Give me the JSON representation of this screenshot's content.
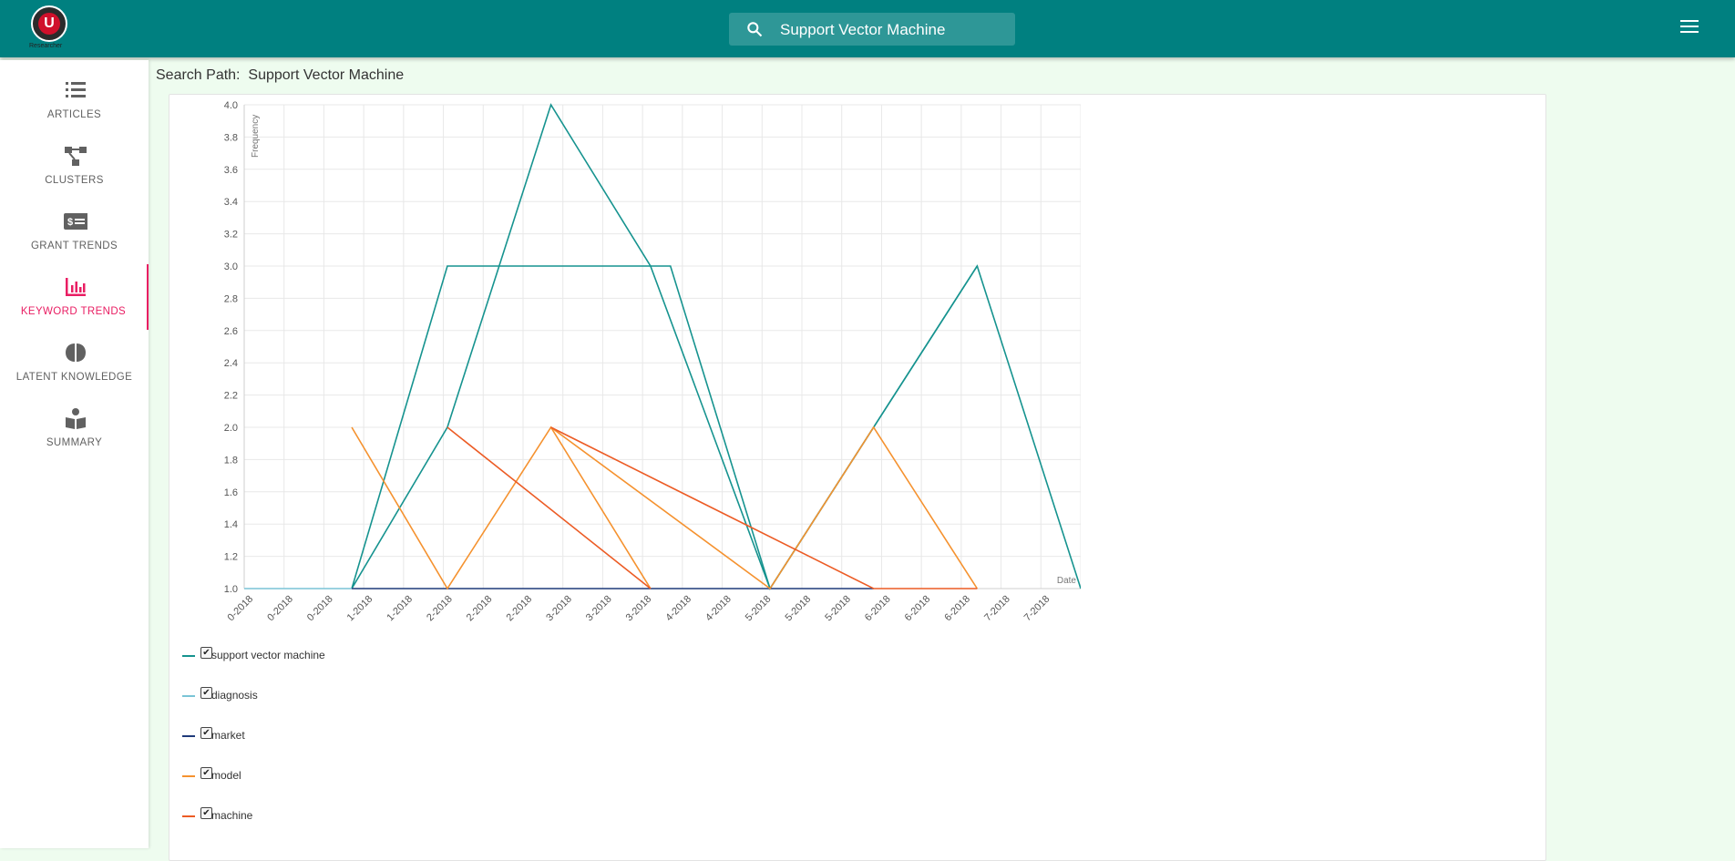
{
  "app": {
    "logo_text": "Researcher",
    "logo_letter": "U"
  },
  "search": {
    "value": "Support Vector Machine"
  },
  "sidebar": {
    "items": [
      {
        "label": "ARTICLES",
        "icon": "list-icon",
        "active": false
      },
      {
        "label": "CLUSTERS",
        "icon": "cluster-icon",
        "active": false
      },
      {
        "label": "GRANT TRENDS",
        "icon": "money-card-icon",
        "active": false
      },
      {
        "label": "KEYWORD TRENDS",
        "icon": "bar-chart-icon",
        "active": true
      },
      {
        "label": "LATENT KNOWLEDGE",
        "icon": "brain-icon",
        "active": false
      },
      {
        "label": "SUMMARY",
        "icon": "reader-icon",
        "active": false
      }
    ]
  },
  "main": {
    "search_path_label": "Search Path:",
    "search_path_value": "Support Vector Machine"
  },
  "chart_data": {
    "type": "line",
    "ylabel": "Frequency",
    "xlabel": "Date",
    "ylim": [
      1.0,
      4.0
    ],
    "yticks": [
      "1.0",
      "1.2",
      "1.4",
      "1.6",
      "1.8",
      "2.0",
      "2.2",
      "2.4",
      "2.6",
      "2.8",
      "3.0",
      "3.2",
      "3.4",
      "3.6",
      "3.8",
      "4.0"
    ],
    "categories": [
      "0-2018",
      "0-2018",
      "0-2018",
      "1-2018",
      "1-2018",
      "2-2018",
      "2-2018",
      "2-2018",
      "3-2018",
      "3-2018",
      "3-2018",
      "4-2018",
      "4-2018",
      "5-2018",
      "5-2018",
      "5-2018",
      "6-2018",
      "6-2018",
      "6-2018",
      "7-2018",
      "7-2018"
    ],
    "series": [
      {
        "name": "support vector machine",
        "color": "#16938f",
        "points": [
          [
            2.7,
            1.0
          ],
          [
            5.1,
            3.0
          ],
          [
            10.7,
            3.0
          ],
          [
            13.2,
            1.0
          ],
          [
            15.8,
            2.0
          ],
          [
            18.4,
            3.0
          ],
          [
            21.0,
            1.0
          ]
        ]
      },
      {
        "name": "support vector machine",
        "color": "#16938f",
        "points": [
          [
            2.7,
            1.0
          ],
          [
            5.1,
            2.0
          ],
          [
            7.7,
            4.0
          ],
          [
            10.2,
            3.0
          ],
          [
            13.2,
            1.0
          ],
          [
            18.4,
            3.0
          ]
        ]
      },
      {
        "name": "diagnosis",
        "color": "#7ac4d6",
        "points": [
          [
            0.0,
            1.0
          ],
          [
            2.7,
            1.0
          ]
        ]
      },
      {
        "name": "market",
        "color": "#1f3a7a",
        "points": [
          [
            2.7,
            1.0
          ],
          [
            15.8,
            1.0
          ]
        ]
      },
      {
        "name": "model",
        "color": "#f5922f",
        "points": [
          [
            2.7,
            2.0
          ],
          [
            5.1,
            1.0
          ],
          [
            7.7,
            2.0
          ],
          [
            10.2,
            1.0
          ]
        ]
      },
      {
        "name": "model",
        "color": "#f5922f",
        "points": [
          [
            7.7,
            2.0
          ],
          [
            13.2,
            1.0
          ],
          [
            15.8,
            2.0
          ],
          [
            18.4,
            1.0
          ]
        ]
      },
      {
        "name": "machine",
        "color": "#ec5b24",
        "points": [
          [
            5.1,
            2.0
          ],
          [
            10.2,
            1.0
          ]
        ]
      },
      {
        "name": "machine",
        "color": "#ec5b24",
        "points": [
          [
            7.7,
            2.0
          ],
          [
            15.8,
            1.0
          ],
          [
            18.4,
            1.0
          ]
        ]
      }
    ],
    "legend": [
      {
        "name": "support vector machine",
        "color": "#16938f",
        "checked": true
      },
      {
        "name": "diagnosis",
        "color": "#7ac4d6",
        "checked": true
      },
      {
        "name": "market",
        "color": "#1f3a7a",
        "checked": true
      },
      {
        "name": "model",
        "color": "#f5922f",
        "checked": true
      },
      {
        "name": "machine",
        "color": "#ec5b24",
        "checked": true
      }
    ]
  }
}
